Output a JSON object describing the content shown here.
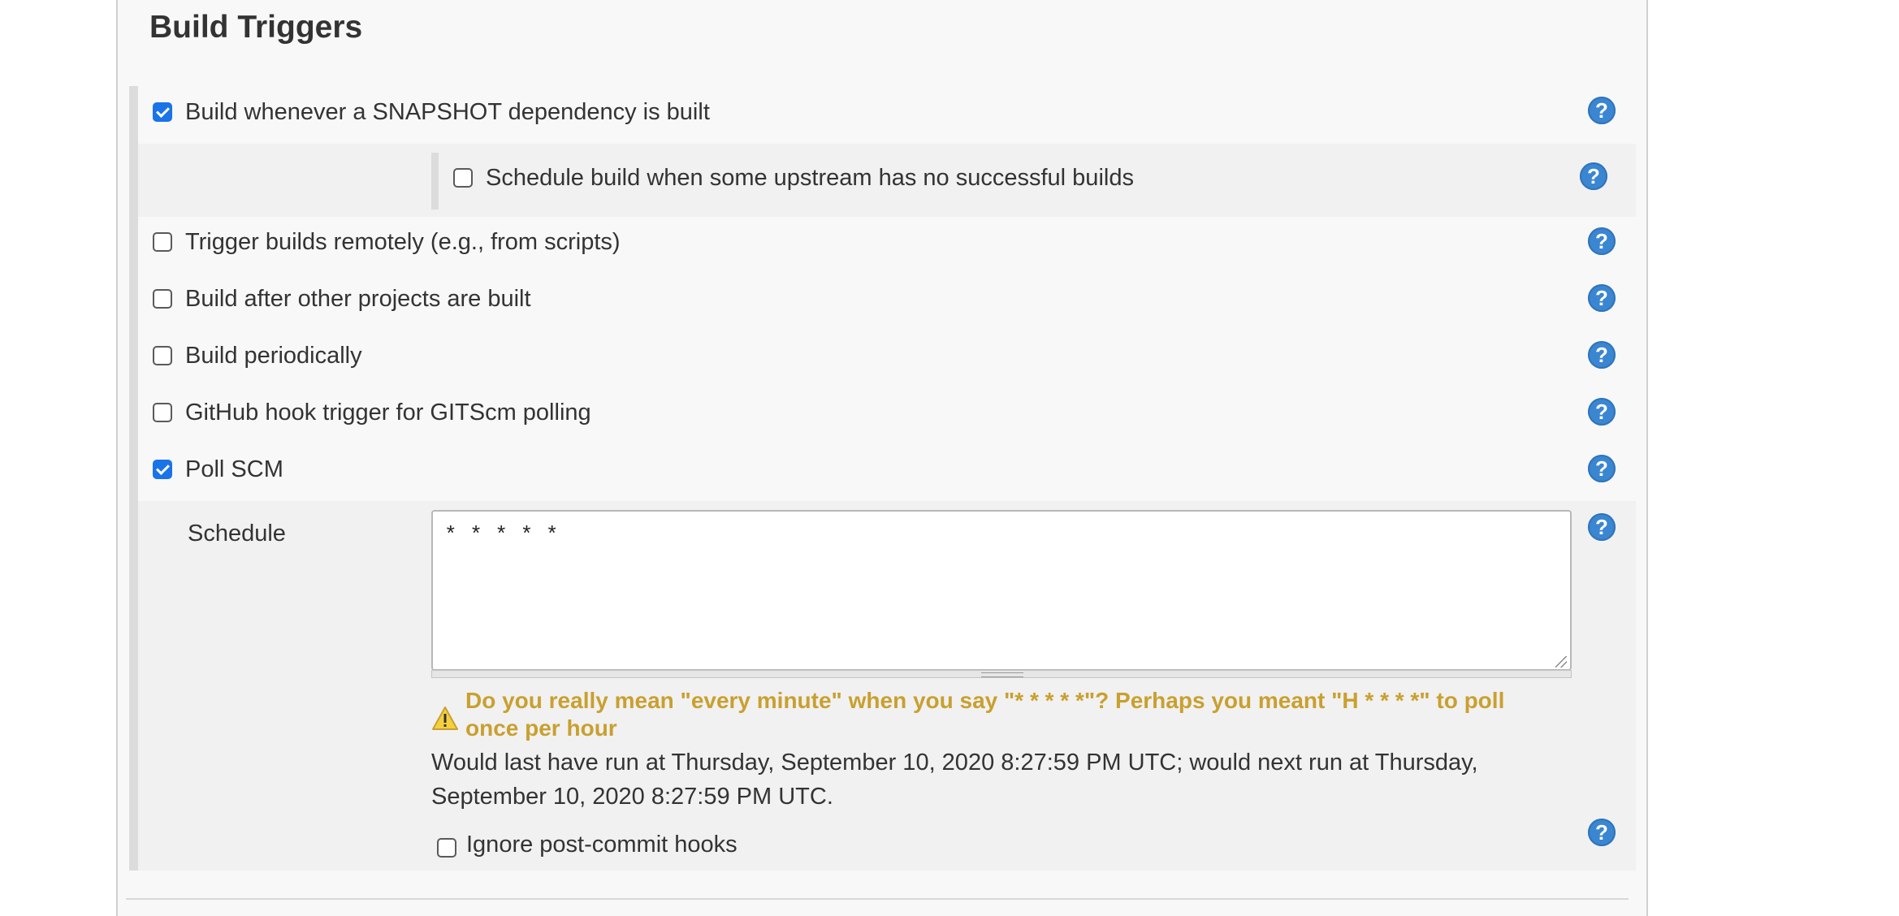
{
  "section": {
    "title": "Build Triggers"
  },
  "triggers": {
    "snapshot": {
      "label": "Build whenever a SNAPSHOT dependency is built",
      "checked": true
    },
    "upstream": {
      "label": "Schedule build when some upstream has no successful builds",
      "checked": false
    },
    "remote": {
      "label": "Trigger builds remotely (e.g., from scripts)",
      "checked": false
    },
    "after_other": {
      "label": "Build after other projects are built",
      "checked": false
    },
    "periodic": {
      "label": "Build periodically",
      "checked": false
    },
    "github_hook": {
      "label": "GitHub hook trigger for GITScm polling",
      "checked": false
    },
    "poll_scm": {
      "label": "Poll SCM",
      "checked": true
    }
  },
  "poll": {
    "schedule_label": "Schedule",
    "schedule_value": "* * * * *",
    "warning": "Do you really mean \"every minute\" when you say \"* * * * *\"? Perhaps you meant \"H * * * *\" to poll once per hour",
    "info": "Would last have run at Thursday, September 10, 2020 8:27:59 PM UTC; would next run at Thursday, September 10, 2020 8:27:59 PM UTC.",
    "ignore_hooks": {
      "label": "Ignore post-commit hooks",
      "checked": false
    }
  },
  "help": {
    "glyph": "?"
  },
  "colors": {
    "help_icon": "#3a86d1",
    "checkbox_checked": "#1a73e8",
    "warning_text": "#c9a02f"
  },
  "icons": {
    "help": "question-circle-icon",
    "warning": "warning-triangle-icon",
    "checkmark": "checkmark-icon"
  }
}
